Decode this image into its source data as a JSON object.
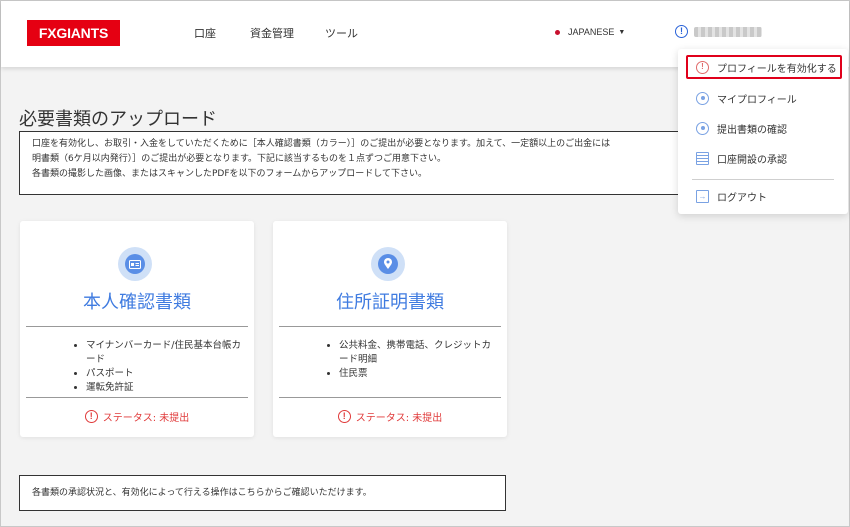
{
  "header": {
    "logo_text": "FXGIANTS",
    "nav": [
      "口座",
      "資金管理",
      "ツール"
    ],
    "language": "JAPANESE",
    "brand_color": "#e50012"
  },
  "main": {
    "title": "必要書類のアップロード",
    "notice_lines": [
      "口座を有効化し、お取引・入金をしていただくために［本人確認書類（カラー）］のご提出が必要となります。加えて、一定額以上のご出金には",
      "明書類（6ケ月以内発行）］のご提出が必要となります。下記に該当するものを１点ずつご用意下さい。",
      "各書類の撮影した画像、またはスキャンしたPDFを以下のフォームからアップロードして下さい。"
    ],
    "cards": [
      {
        "title": "本人確認書類",
        "icon": "id-card-icon",
        "items": [
          "マイナンバーカード/住民基本台帳カード",
          "パスポート",
          "運転免許証"
        ],
        "status": "ステータス: 未提出"
      },
      {
        "title": "住所証明書類",
        "icon": "location-pin-icon",
        "items": [
          "公共料金、携帯電話、クレジットカード明細",
          "住民票"
        ],
        "status": "ステータス: 未提出"
      }
    ],
    "bottom_note": "各書類の承認状況と、有効化によって行える操作はこちらからご確認いただけます。",
    "accent_color": "#3f7be0",
    "status_color": "#e03a3a"
  },
  "dropdown": {
    "items": [
      {
        "label": "プロフィールを有効化する",
        "icon": "warning-icon"
      },
      {
        "label": "マイプロフィール",
        "icon": "user-icon"
      },
      {
        "label": "提出書類の確認",
        "icon": "user-icon"
      },
      {
        "label": "口座開設の承認",
        "icon": "list-icon"
      },
      {
        "label": "ログアウト",
        "icon": "logout-icon"
      }
    ]
  }
}
